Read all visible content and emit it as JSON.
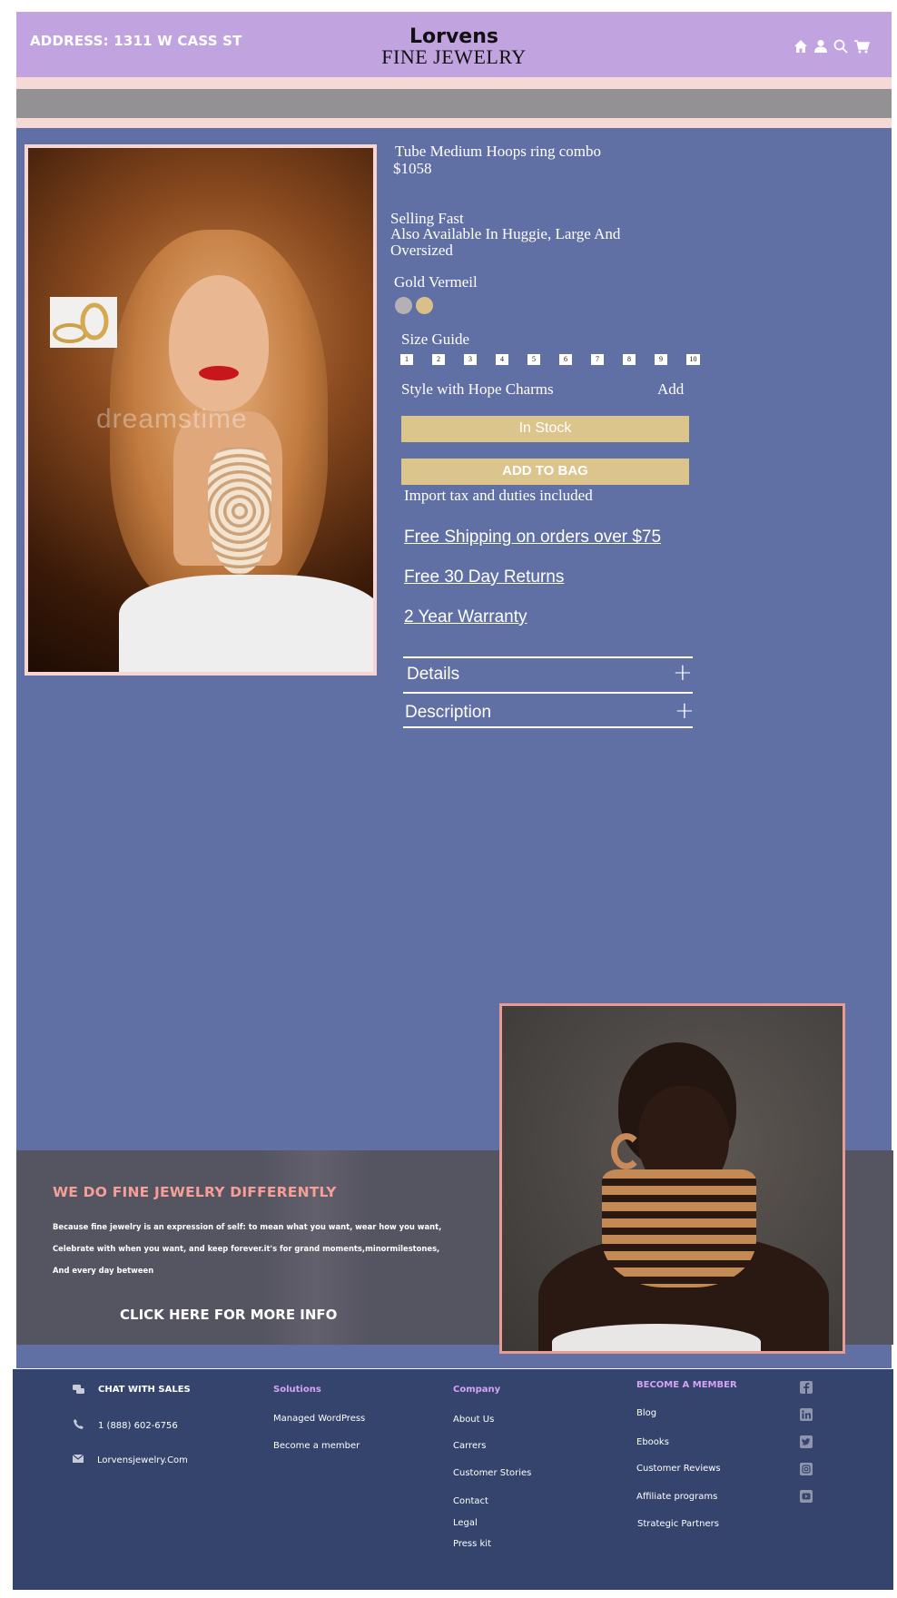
{
  "header": {
    "address": "ADDRESS: 1311 W CASS ST",
    "brand_name": "Lorvens",
    "brand_sub": "FINE JEWELRY",
    "icons": [
      "home-icon",
      "user-icon",
      "search-icon",
      "cart-icon"
    ]
  },
  "product": {
    "watermark": "dreamstime",
    "title": "Tube Medium Hoops ring combo",
    "price": "$1058",
    "selling": "Selling Fast",
    "also": "Also Available In Huggie, Large And Oversized",
    "metal": "Gold Vermeil",
    "swatches": [
      "#b3b1b5",
      "#d9c08a"
    ],
    "size_guide": "Size Guide",
    "sizes": [
      "1",
      "2",
      "3",
      "4",
      "5",
      "6",
      "7",
      "8",
      "9",
      "10"
    ],
    "style_with": "Style with Hope Charms",
    "add": "Add",
    "stock": "In Stock",
    "add_to_bag": "ADD TO BAG",
    "tax": "Import tax and duties included",
    "link_shipping": "Free Shipping on orders over $75",
    "link_returns": "Free 30 Day Returns",
    "link_warranty": "2 Year Warranty",
    "accordion": [
      "Details",
      "Description"
    ]
  },
  "promo": {
    "title": "WE DO FINE JEWELRY DIFFERENTLY",
    "body_lines": [
      "Because fine jewelry is an expression of self: to mean what you want, wear how you want,",
      "Celebrate with when you want, and keep forever.it's for grand moments,minormilestones,",
      "And every day between"
    ],
    "cta": "CLICK HERE FOR MORE INFO"
  },
  "footer": {
    "contact": {
      "chat": "CHAT WITH SALES",
      "phone": "1 (888) 602-6756",
      "email": "Lorvensjewelry.Com"
    },
    "solutions": {
      "heading": "Solutions",
      "items": [
        "Managed WordPress",
        "Become a member"
      ]
    },
    "company": {
      "heading": "Company",
      "items": [
        "About Us",
        "Carrers",
        "Customer Stories",
        "Contact",
        "Legal",
        "Press kit"
      ]
    },
    "member": {
      "heading": "BECOME A MEMBER",
      "items": [
        "Blog",
        "Ebooks",
        "Customer Reviews",
        "Affiliate programs",
        "Strategic Partners"
      ]
    },
    "social": [
      "facebook-icon",
      "linkedin-icon",
      "twitter-icon",
      "instagram-icon",
      "youtube-icon"
    ]
  },
  "colors": {
    "header_bg": "#c1a3e0",
    "main_bg": "#6170a4",
    "button_gold": "#dcc48d",
    "promo_bg": "#555461",
    "promo_title": "#f59f98",
    "footer_bg": "#34446d",
    "footer_heading": "#d5a2f5"
  }
}
